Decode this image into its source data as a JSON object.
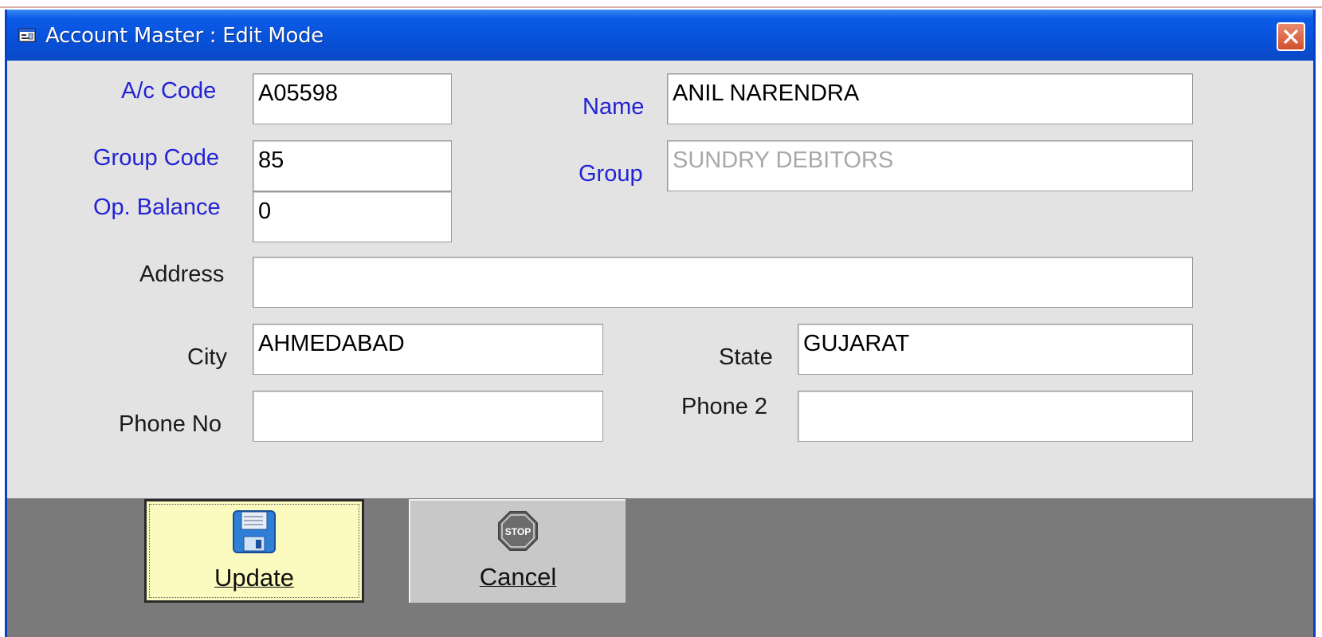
{
  "window": {
    "title": "Account Master : Edit Mode",
    "icons": {
      "app": "form-window-icon",
      "close": "close-icon"
    }
  },
  "form": {
    "ac_code": {
      "label": "A/c Code",
      "value": "A05598"
    },
    "name": {
      "label": "Name",
      "value": "ANIL NARENDRA"
    },
    "group_code": {
      "label": "Group Code",
      "value": "85"
    },
    "group": {
      "label": "Group",
      "value": "SUNDRY DEBITORS"
    },
    "op_balance": {
      "label": "Op. Balance",
      "value": "0"
    },
    "address": {
      "label": "Address",
      "value": ""
    },
    "city": {
      "label": "City",
      "value": "AHMEDABAD"
    },
    "state": {
      "label": "State",
      "value": "GUJARAT"
    },
    "phone_no": {
      "label": "Phone No",
      "value": ""
    },
    "phone2": {
      "label": "Phone 2",
      "value": ""
    }
  },
  "buttons": {
    "update": {
      "label": "Update",
      "icon": "floppy-disk-icon"
    },
    "cancel": {
      "label": "Cancel",
      "icon": "stop-sign-icon",
      "icon_text": "STOP"
    }
  },
  "colors": {
    "titlebar": "#0751d9",
    "key_label": "#2323d6",
    "update_bg": "#fbfbc0",
    "bottom_bar": "#7a7a7a"
  }
}
